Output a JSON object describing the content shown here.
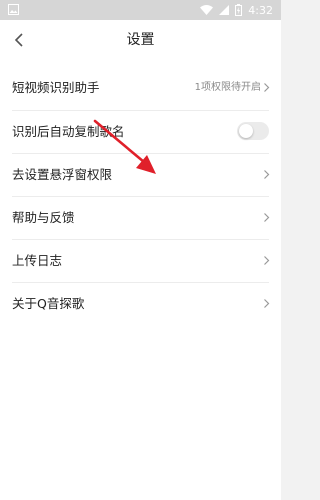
{
  "status_bar": {
    "time": "4:32"
  },
  "header": {
    "title": "设置"
  },
  "items": [
    {
      "label": "短视频识别助手",
      "value": "1项权限待开启"
    },
    {
      "label": "识别后自动复制歌名"
    },
    {
      "label": "去设置悬浮窗权限"
    },
    {
      "label": "帮助与反馈"
    },
    {
      "label": "上传日志"
    },
    {
      "label": "关于Q音探歌"
    }
  ],
  "colors": {
    "annotation_arrow": "#e0202a",
    "toggle_off": "#ebebeb"
  }
}
